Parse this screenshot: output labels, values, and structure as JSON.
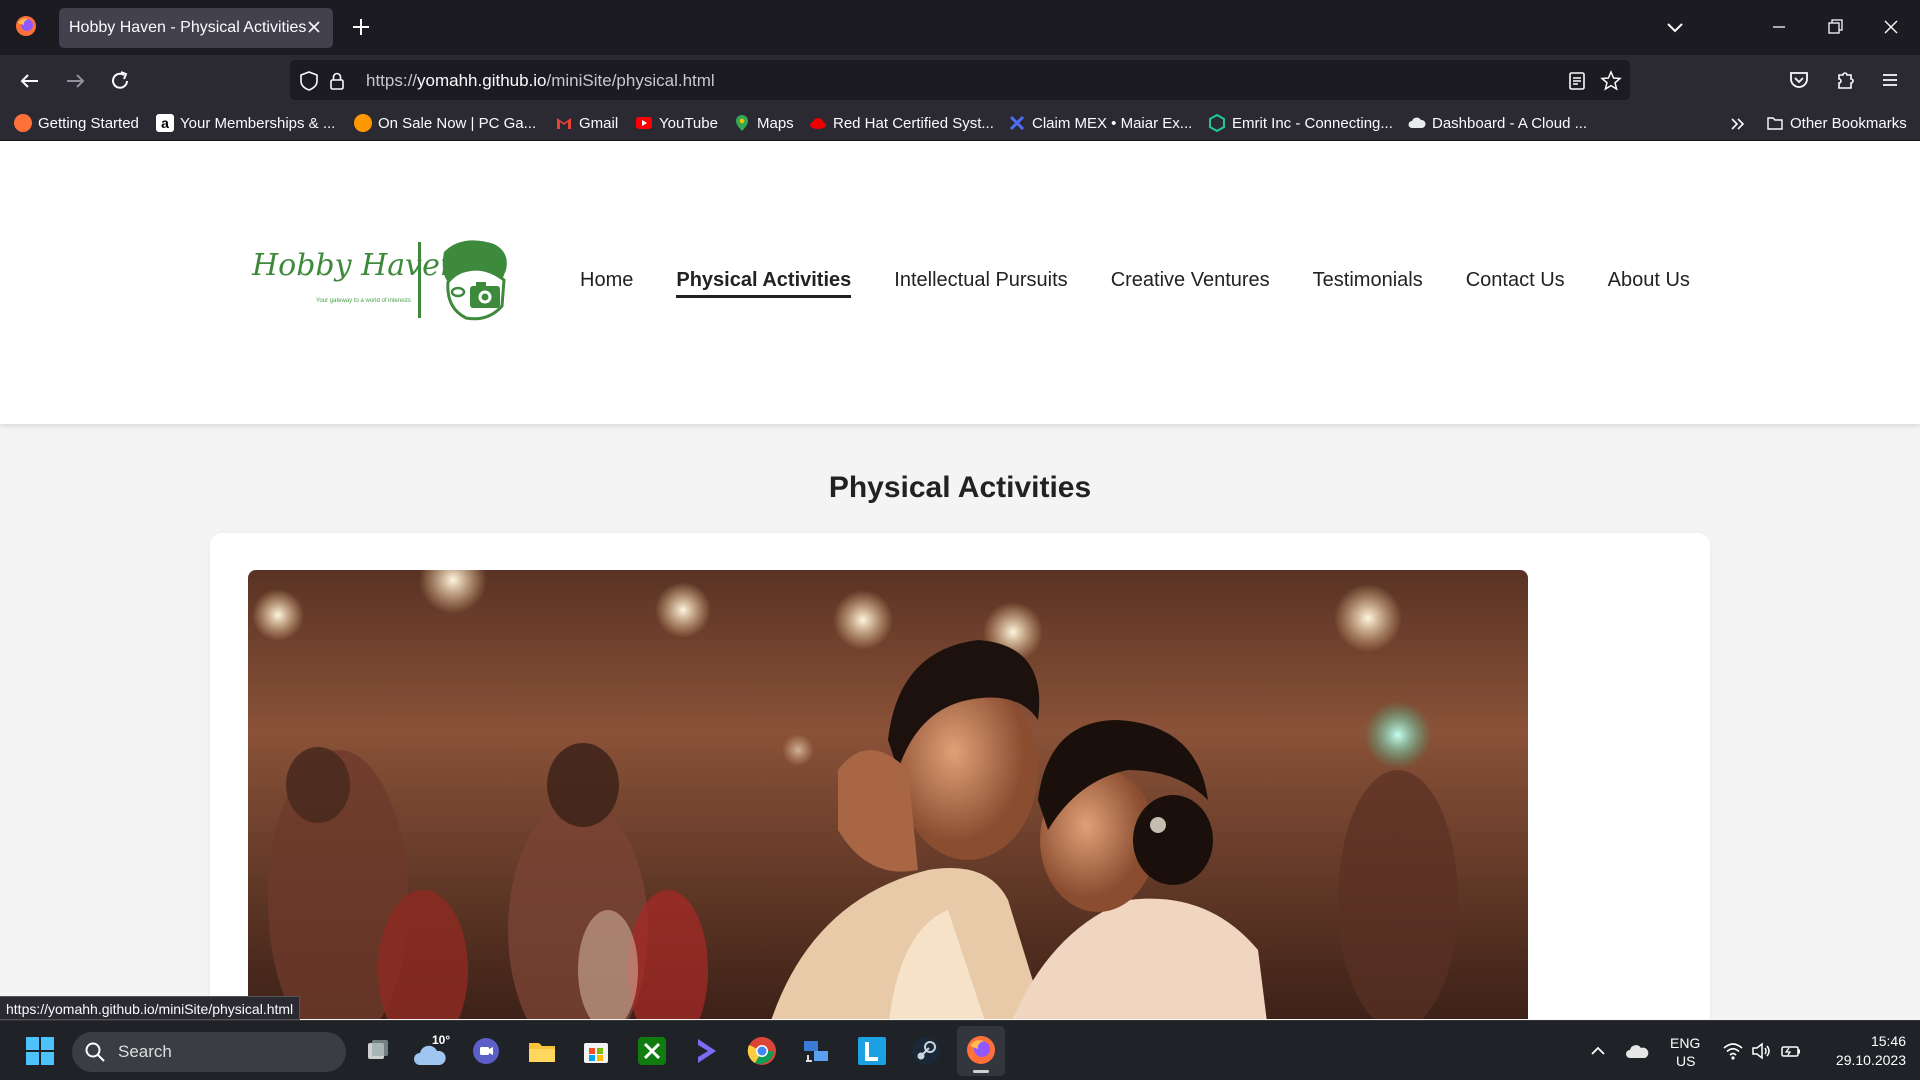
{
  "browser": {
    "tab_title": "Hobby Haven - Physical Activities",
    "url_prefix": "https://",
    "url_host": "yomahh.github.io",
    "url_path": "/miniSite/physical.html",
    "status_url": "https://yomahh.github.io/miniSite/physical.html",
    "bookmarks": [
      {
        "label": "Getting Started",
        "icon": "firefox-icon",
        "color": "#ff7139"
      },
      {
        "label": "Your Memberships & ...",
        "icon": "amazon-icon",
        "color": "#ffffff"
      },
      {
        "label": "On Sale Now | PC Ga...",
        "icon": "fanatical-icon",
        "color": "#ff9800"
      },
      {
        "label": "Gmail",
        "icon": "gmail-icon",
        "color": "#ea4335"
      },
      {
        "label": "YouTube",
        "icon": "youtube-icon",
        "color": "#ff0000"
      },
      {
        "label": "Maps",
        "icon": "maps-pin-icon",
        "color": "#34a853"
      },
      {
        "label": "Red Hat Certified Syst...",
        "icon": "redhat-icon",
        "color": "#ee0000"
      },
      {
        "label": "Claim MEX • Maiar Ex...",
        "icon": "maiar-icon",
        "color": "#3b5bdb"
      },
      {
        "label": "Emrit Inc - Connecting...",
        "icon": "emrit-icon",
        "color": "#20c997"
      },
      {
        "label": "Dashboard - A Cloud ...",
        "icon": "cloud-icon",
        "color": "#e9ecef"
      }
    ],
    "other_bookmarks": "Other Bookmarks"
  },
  "site": {
    "logo_text": "Hobby Haven",
    "logo_tagline": "Your gateway to a world of interests",
    "nav": [
      "Home",
      "Physical Activities",
      "Intellectual Pursuits",
      "Creative Ventures",
      "Testimonials",
      "Contact Us",
      "About Us"
    ],
    "active_nav": "Physical Activities",
    "page_title": "Physical Activities"
  },
  "taskbar": {
    "search_label": "Search",
    "weather_temp": "10°",
    "lang_top": "ENG",
    "lang_bottom": "US",
    "time": "15:46",
    "date": "29.10.2023"
  },
  "colors": {
    "brand_green": "#3d8a3c",
    "chrome_dark": "#1c1b22",
    "chrome_mid": "#2b2a33"
  }
}
